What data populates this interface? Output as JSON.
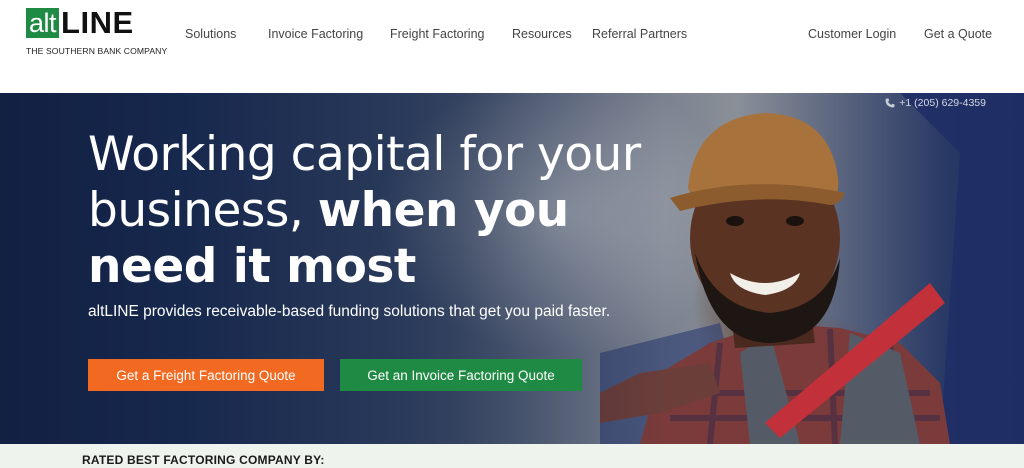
{
  "header": {
    "logo": {
      "alt_text": "alt",
      "line_text": "LINE",
      "tagline": "THE SOUTHERN BANK COMPANY"
    },
    "nav": [
      {
        "label": "Solutions"
      },
      {
        "label": "Invoice Factoring"
      },
      {
        "label": "Freight Factoring"
      },
      {
        "label": "Resources"
      },
      {
        "label": "Referral Partners"
      }
    ],
    "customer_login": "Customer Login",
    "get_quote": "Get a Quote"
  },
  "hero": {
    "phone": "+1 (205) 629-4359",
    "headline_part1": "Working capital for your business,",
    "headline_part2": "when you need it most",
    "subtext": "altLINE provides receivable-based funding solutions that get you paid faster.",
    "buttons": {
      "freight": "Get a Freight Factoring Quote",
      "invoice": "Get an Invoice Factoring Quote"
    }
  },
  "rated": {
    "label": "RATED BEST FACTORING COMPANY BY:"
  },
  "colors": {
    "brand_green": "#1f8a43",
    "accent_orange": "#f26a21",
    "hero_blue": "#1b2f5c"
  }
}
